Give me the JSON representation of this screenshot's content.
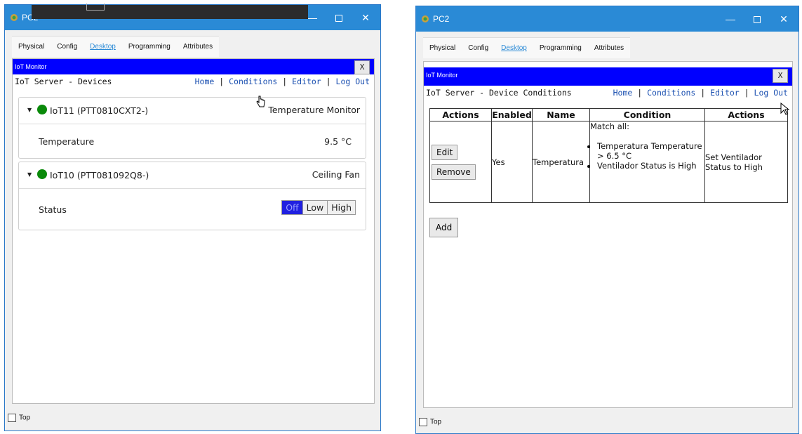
{
  "left_window": {
    "title": "PC2",
    "tabs": [
      "Physical",
      "Config",
      "Desktop",
      "Programming",
      "Attributes"
    ],
    "active_tab": "Desktop",
    "iot_monitor_label": "IoT Monitor",
    "close_label": "X",
    "server_title": "IoT Server - Devices",
    "nav": {
      "home": "Home",
      "conditions": "Conditions",
      "editor": "Editor",
      "logout": "Log Out",
      "separator": "|"
    },
    "devices": [
      {
        "name": "IoT11 (PTT0810CXT2-)",
        "type": "Temperature Monitor",
        "status_color": "#0a8a0a",
        "prop_label": "Temperature",
        "prop_value": "9.5 °C"
      },
      {
        "name": "IoT10 (PTT081092Q8-)",
        "type": "Ceiling Fan",
        "status_color": "#0a8a0a",
        "prop_label": "Status",
        "options": [
          "Off",
          "Low",
          "High"
        ],
        "selected": "Off"
      }
    ],
    "top_checkbox_label": "Top"
  },
  "right_window": {
    "title": "PC2",
    "tabs": [
      "Physical",
      "Config",
      "Desktop",
      "Programming",
      "Attributes"
    ],
    "active_tab": "Desktop",
    "iot_monitor_label": "IoT Monitor",
    "close_label": "X",
    "server_title": "IoT Server - Device Conditions",
    "nav": {
      "home": "Home",
      "conditions": "Conditions",
      "editor": "Editor",
      "logout": "Log Out",
      "separator": "|"
    },
    "table": {
      "headers": [
        "Actions",
        "Enabled",
        "Name",
        "Condition",
        "Actions"
      ],
      "row": {
        "edit_label": "Edit",
        "remove_label": "Remove",
        "enabled": "Yes",
        "name": "Temperatura",
        "condition_title": "Match all:",
        "condition_items": [
          "Temperatura Temperature > 6.5 °C",
          "Ventilador Status is High"
        ],
        "action": "Set Ventilador Status to High"
      }
    },
    "add_label": "Add",
    "top_checkbox_label": "Top"
  },
  "colors": {
    "titlebar": "#2a8ad6",
    "iot_bar": "#0000ff",
    "link": "#1a4fb0",
    "status_dot": "#0a8a0a",
    "seg_selected": "#2020e0"
  },
  "icons": [
    "app-icon",
    "chevron-down-icon",
    "status-dot-icon",
    "hand-cursor-icon",
    "arrow-cursor-icon"
  ]
}
